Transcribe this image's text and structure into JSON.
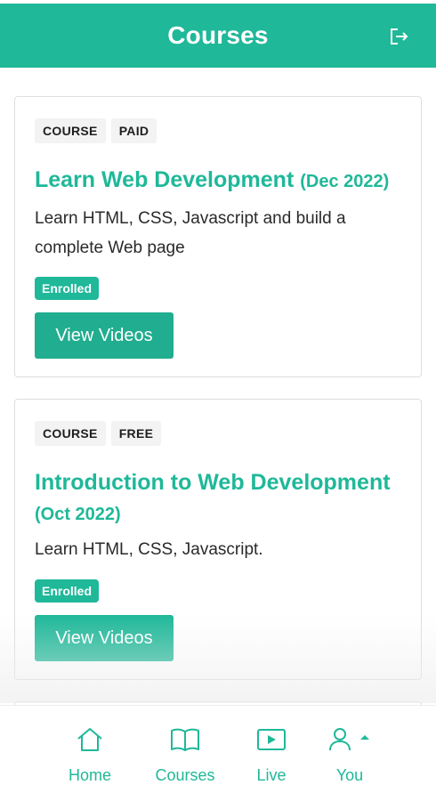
{
  "header": {
    "title": "Courses",
    "logout_icon": "logout-icon"
  },
  "courses": [
    {
      "tags": [
        "COURSE",
        "PAID"
      ],
      "title": "Learn Web Development",
      "date": "(Dec 2022)",
      "description": "Learn HTML, CSS, Javascript and build a complete Web page",
      "status": "Enrolled",
      "button_label": "View Videos"
    },
    {
      "tags": [
        "COURSE",
        "FREE"
      ],
      "title": "Introduction to Web Development",
      "date": "(Oct 2022)",
      "description": "Learn HTML, CSS, Javascript.",
      "status": "Enrolled",
      "button_label": "View Videos"
    }
  ],
  "bottom_nav": {
    "items": [
      {
        "label": "Home",
        "icon": "home-icon"
      },
      {
        "label": "Courses",
        "icon": "book-icon"
      },
      {
        "label": "Live",
        "icon": "play-icon"
      },
      {
        "label": "You",
        "icon": "user-icon"
      }
    ]
  },
  "colors": {
    "accent": "#1fb899",
    "header_bg": "#1fb899",
    "card_border": "#dedede",
    "tag_bg": "#f3f3f3",
    "text": "#2a2a2a"
  }
}
